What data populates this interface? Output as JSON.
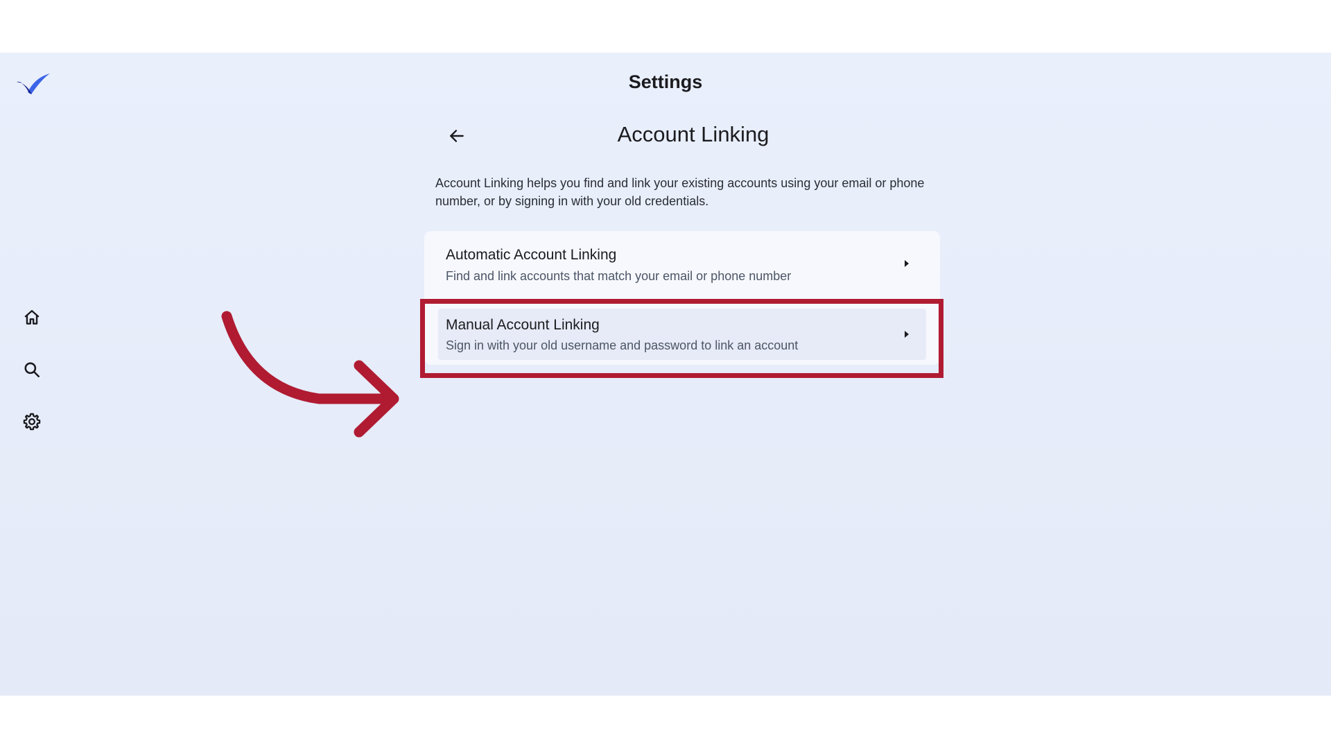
{
  "header": {
    "title": "Settings"
  },
  "sidebar": {
    "logo": "brand-check-logo",
    "items": [
      {
        "name": "home",
        "icon": "home-icon"
      },
      {
        "name": "search",
        "icon": "search-icon"
      },
      {
        "name": "settings",
        "icon": "gear-icon"
      }
    ]
  },
  "page": {
    "back_icon": "arrow-left-icon",
    "title": "Account Linking",
    "description": "Account Linking helps you find and link your existing accounts using your email or phone number, or by signing in with your old credentials.",
    "options": [
      {
        "title": "Automatic Account Linking",
        "subtitle": "Find and link accounts that match your email or phone number"
      },
      {
        "title": "Manual Account Linking",
        "subtitle": "Sign in with your old username and password to link an account"
      }
    ]
  },
  "annotation": {
    "color": "#b01b32",
    "highlight_target": "Manual Account Linking"
  },
  "colors": {
    "background": "#e9effb",
    "card": "#f6f8fd",
    "brand_dark": "#1a2ea8",
    "brand_light": "#3c63e8"
  }
}
